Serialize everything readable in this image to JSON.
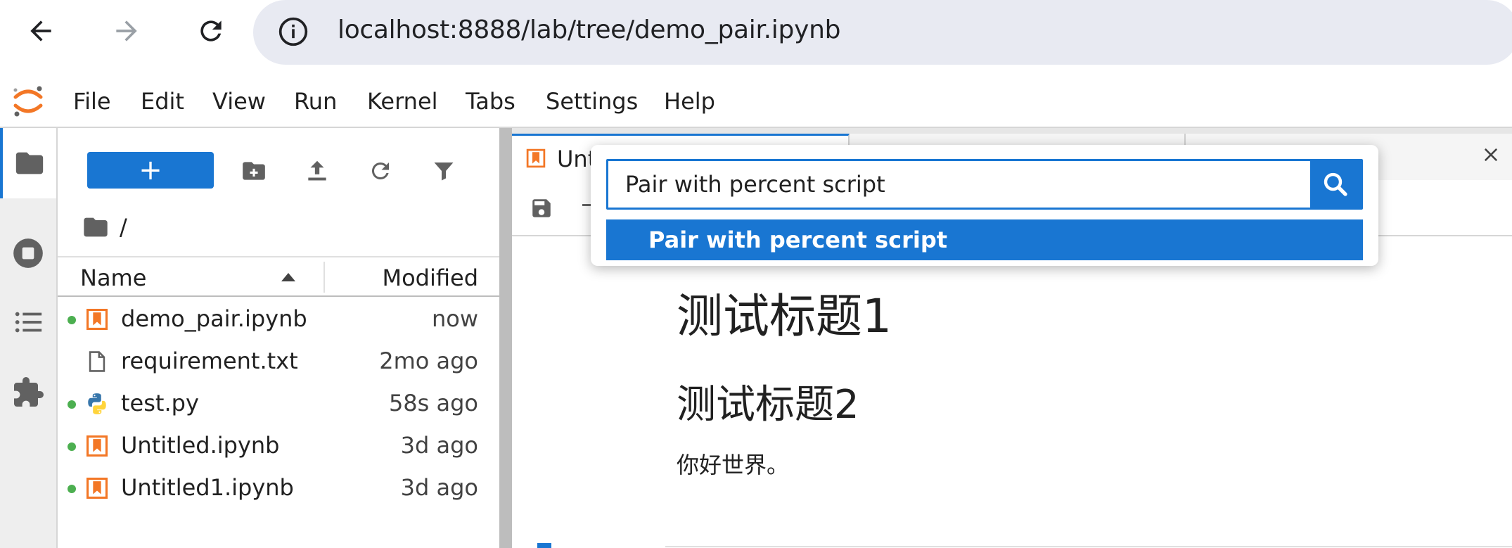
{
  "browser": {
    "url": "localhost:8888/lab/tree/demo_pair.ipynb"
  },
  "menu": {
    "items": [
      "File",
      "Edit",
      "View",
      "Run",
      "Kernel",
      "Tabs",
      "Settings",
      "Help"
    ]
  },
  "filebrowser": {
    "new_label": "+",
    "breadcrumb": "/",
    "columns": {
      "name": "Name",
      "modified": "Modified"
    },
    "files": [
      {
        "name": "demo_pair.ipynb",
        "modified": "now",
        "running": true,
        "type": "notebook"
      },
      {
        "name": "requirement.txt",
        "modified": "2mo ago",
        "running": false,
        "type": "text"
      },
      {
        "name": "test.py",
        "modified": "58s ago",
        "running": true,
        "type": "python"
      },
      {
        "name": "Untitled.ipynb",
        "modified": "3d ago",
        "running": true,
        "type": "notebook"
      },
      {
        "name": "Untitled1.ipynb",
        "modified": "3d ago",
        "running": true,
        "type": "notebook"
      }
    ]
  },
  "tabs": {
    "active_label": "Unt"
  },
  "notebook": {
    "heading1": "测试标题1",
    "heading2": "测试标题2",
    "paragraph": "你好世界。"
  },
  "palette": {
    "query": "Pair with percent script",
    "result": "Pair with percent script"
  },
  "colors": {
    "accent": "#1976d2",
    "notebook_icon": "#f37726",
    "running_dot": "#4caf50"
  }
}
